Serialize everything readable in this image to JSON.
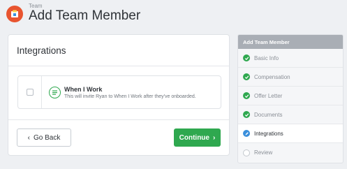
{
  "header": {
    "breadcrumb": "Team",
    "title": "Add Team Member"
  },
  "card": {
    "title": "Integrations",
    "integration": {
      "name": "When I Work",
      "description": "This will invite Ryan to When I Work after they've onboarded.",
      "checked": false,
      "icon": "list-circle-icon"
    },
    "back_label": "Go Back",
    "continue_label": "Continue"
  },
  "steps": {
    "title": "Add Team Member",
    "items": [
      {
        "label": "Basic Info",
        "status": "done"
      },
      {
        "label": "Compensation",
        "status": "done"
      },
      {
        "label": "Offer Letter",
        "status": "done"
      },
      {
        "label": "Documents",
        "status": "done"
      },
      {
        "label": "Integrations",
        "status": "current"
      },
      {
        "label": "Review",
        "status": "todo"
      }
    ]
  },
  "colors": {
    "accent_green": "#2fa84f",
    "current_blue": "#3a8fdc",
    "logo_orange": "#e8542f"
  }
}
